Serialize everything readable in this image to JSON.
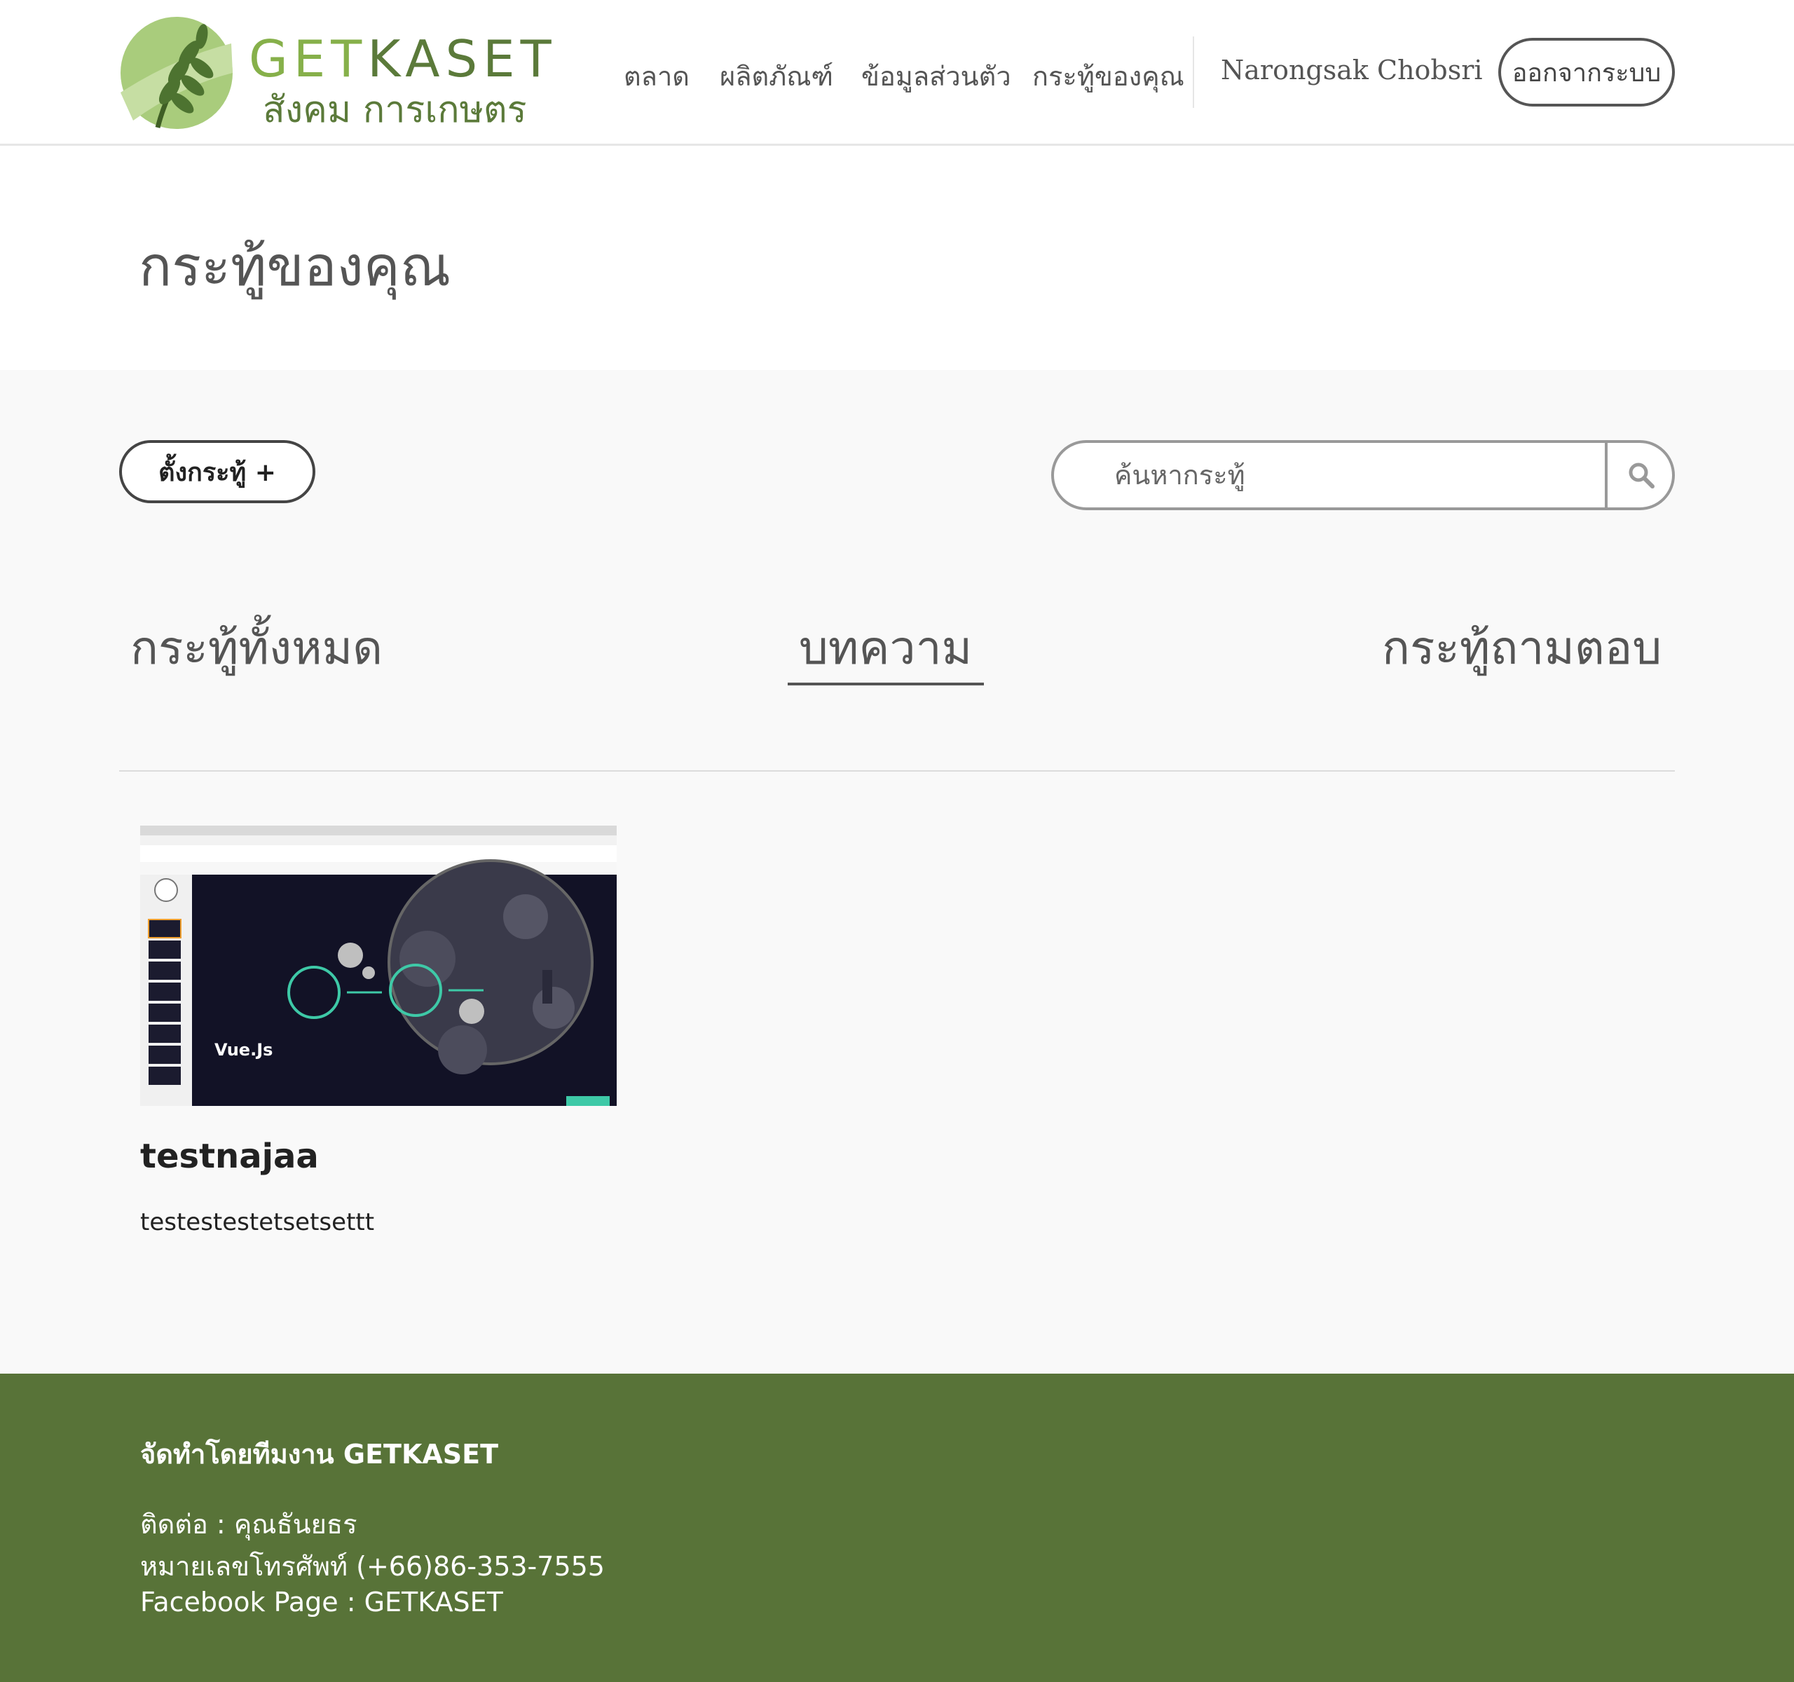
{
  "brand": {
    "title_light": "GET",
    "title_dark": "KASET",
    "subtitle": "สังคม การเกษตร"
  },
  "nav": {
    "items": [
      {
        "label": "ตลาด"
      },
      {
        "label": "ผลิตภัณฑ์"
      },
      {
        "label": "ข้อมูลส่วนตัว"
      },
      {
        "label": "กระทู้ของคุณ"
      }
    ],
    "user_name": "Narongsak Chobsri",
    "logout_label": "ออกจากระบบ"
  },
  "page": {
    "title": "กระทู้ของคุณ"
  },
  "toolbar": {
    "create_label": "ตั้งกระทู้ +",
    "search_placeholder": "ค้นหากระทู้",
    "search_icon": "search-icon"
  },
  "tabs": [
    {
      "label": "กระทู้ทั้งหมด",
      "active": false
    },
    {
      "label": "บทความ",
      "active": true
    },
    {
      "label": "กระทู้ถามตอบ",
      "active": false
    }
  ],
  "posts": [
    {
      "title": "testnajaa",
      "description": "testestestetsetsettt",
      "thumbnail_caption": "Vue.Js"
    }
  ],
  "footer": {
    "title": "จัดทำโดยทีมงาน GETKASET",
    "lines": [
      "ติดต่อ : คุณธันยธร",
      "หมายเลขโทรศัพท์ (+66)86-353-7555",
      "Facebook Page : GETKASET"
    ]
  },
  "colors": {
    "brand_green": "#86b04a",
    "brand_dark_green": "#5b7a3a",
    "footer_bg": "#587338",
    "content_bg": "#f9f9f9"
  }
}
